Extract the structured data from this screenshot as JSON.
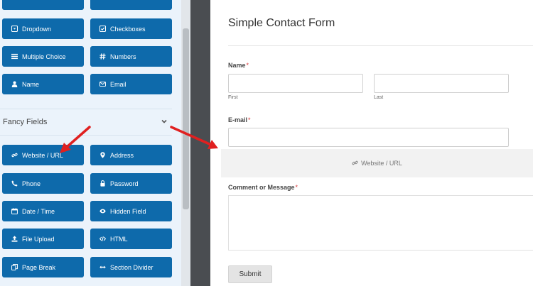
{
  "standard_fields": {
    "dropdown": "Dropdown",
    "checkboxes": "Checkboxes",
    "multiple_choice": "Multiple Choice",
    "numbers": "Numbers",
    "name": "Name",
    "email": "Email"
  },
  "fancy_section": {
    "title": "Fancy Fields"
  },
  "fancy_fields": {
    "website_url": "Website / URL",
    "address": "Address",
    "phone": "Phone",
    "password": "Password",
    "date_time": "Date / Time",
    "hidden_field": "Hidden Field",
    "file_upload": "File Upload",
    "html": "HTML",
    "page_break": "Page Break",
    "section_divider": "Section Divider"
  },
  "form": {
    "title": "Simple Contact Form",
    "name_label": "Name",
    "first_label": "First",
    "last_label": "Last",
    "email_label": "E-mail",
    "drop_placeholder": "Website / URL",
    "comment_label": "Comment or Message",
    "required_mark": "*",
    "submit_label": "Submit"
  },
  "colors": {
    "button_blue": "#0e6aab",
    "annotation_red": "#e02020"
  }
}
